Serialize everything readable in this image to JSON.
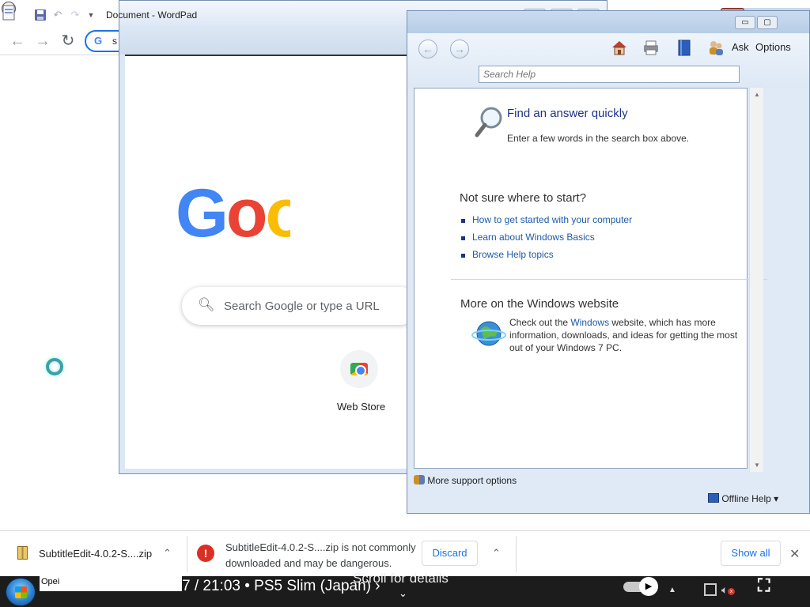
{
  "chrome": {
    "omnibox_text": "s",
    "new_tab_symbol": "+",
    "back_symbol": "←",
    "forward_symbol": "→",
    "reload_symbol": "↻",
    "google_icon": "G"
  },
  "wordpad": {
    "title": "Document - WordPad",
    "minimize": "▭",
    "maximize": "▢",
    "close": "✕"
  },
  "google": {
    "logo_part1": "G",
    "logo_part2": "o",
    "logo_part3": "o",
    "search_placeholder": "Search Google or type a URL",
    "shortcut_label": "Web Store"
  },
  "help": {
    "ask_label": "Ask",
    "options_label": "Options",
    "search_placeholder": "Search Help",
    "find_answer_heading": "Find an answer quickly",
    "find_answer_text": "Enter a few words in the search box above.",
    "not_sure_heading": "Not sure where to start?",
    "links": [
      "How to get started with your computer",
      "Learn about Windows Basics",
      "Browse Help topics"
    ],
    "more_heading": "More on the Windows website",
    "more_text_prefix": "Check out the",
    "more_text_link": "Windows",
    "more_text_suffix": "website, which has more",
    "more_text_line2": "information, downloads, and ideas for getting the most",
    "more_text_line3": "out of your Windows 7 PC.",
    "more_support": "More support options",
    "offline_help": "Offline Help ▾"
  },
  "downloads": {
    "filename": "SubtitleEdit-4.0.2-S....zip",
    "warning_line1": "SubtitleEdit-4.0.2-S....zip is not commonly",
    "warning_line2": "downloaded and may be dangerous.",
    "discard_label": "Discard",
    "show_all_label": "Show all",
    "warn_symbol": "!",
    "close_symbol": "✕",
    "chevron": "⌃"
  },
  "taskbar": {
    "item_label": "Opei",
    "video_title": "7 / 21:03 • PS5 Slim (Japan) ›",
    "scroll_hint": "Scroll for details",
    "scroll_chevron": "⌄",
    "tray_up": "▲",
    "fullscreen_symbol": "⛶"
  },
  "colors": {
    "google_blue": "#4285f4",
    "google_red": "#ea4335",
    "google_yellow": "#fbbc05",
    "chrome_accent": "#1a73e8",
    "danger_red": "#d93025",
    "help_link": "#1e5aa8"
  }
}
